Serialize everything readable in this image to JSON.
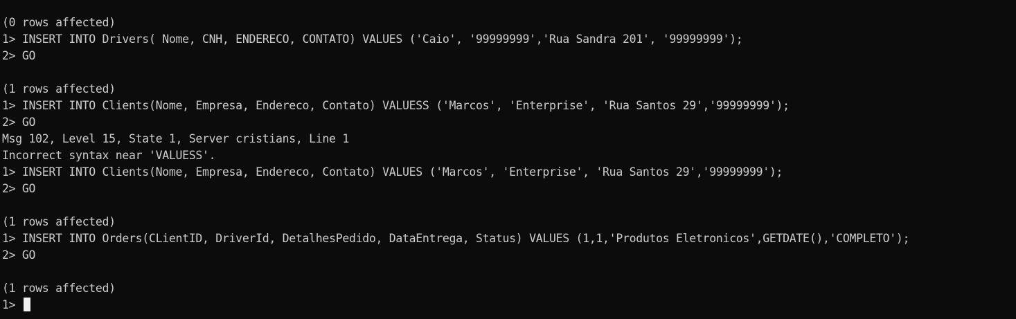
{
  "terminal": {
    "lines": [
      "(0 rows affected)",
      "1> INSERT INTO Drivers( Nome, CNH, ENDERECO, CONTATO) VALUES ('Caio', '99999999','Rua Sandra 201', '99999999');",
      "2> GO",
      "",
      "(1 rows affected)",
      "1> INSERT INTO Clients(Nome, Empresa, Endereco, Contato) VALUESS ('Marcos', 'Enterprise', 'Rua Santos 29','99999999');",
      "2> GO",
      "Msg 102, Level 15, State 1, Server cristians, Line 1",
      "Incorrect syntax near 'VALUESS'.",
      "1> INSERT INTO Clients(Nome, Empresa, Endereco, Contato) VALUES ('Marcos', 'Enterprise', 'Rua Santos 29','99999999');",
      "2> GO",
      "",
      "(1 rows affected)",
      "1> INSERT INTO Orders(CLientID, DriverId, DetalhesPedido, DataEntrega, Status) VALUES (1,1,'Produtos Eletronicos',GETDATE(),'COMPLETO');",
      "2> GO",
      "",
      "(1 rows affected)"
    ],
    "prompt": "1>"
  },
  "colors": {
    "background": "#0c0c0c",
    "text": "#cccccc",
    "cursor": "#f2f2f2"
  }
}
